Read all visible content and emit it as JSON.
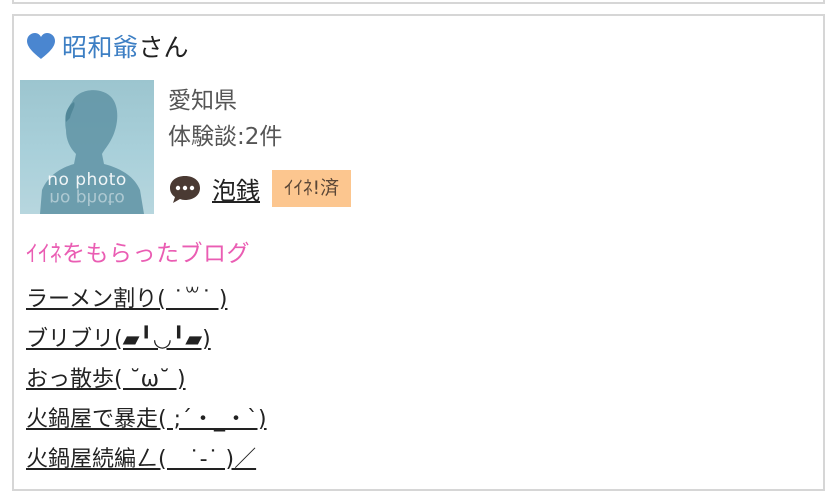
{
  "profile": {
    "name": "昭和爺",
    "honorific": "さん",
    "avatar_label": "no photo",
    "region": "愛知県",
    "reviews": "体験談:2件",
    "tag": "泡銭",
    "like_badge": "ｲｲﾈ!済"
  },
  "blogs": {
    "title": "ｲｲﾈをもらったブログ",
    "items": [
      "ラーメン割り( ˙꒳˙ )",
      "ブリブリ(▰╹◡╹▰)",
      "おっ散歩( ˘ω˘ )",
      "火鍋屋で暴走( ;´・_・`)",
      "火鍋屋続編ㄥ(　˙-˙ )／"
    ]
  },
  "colors": {
    "name_link": "#3d7fc4",
    "heart": "#4a86d0",
    "blog_title": "#ea5db3",
    "badge_bg": "#fcc68f",
    "border": "#d6d6d6"
  },
  "icons": {
    "heart": "heart-icon",
    "chat": "speech-bubble-icon"
  }
}
